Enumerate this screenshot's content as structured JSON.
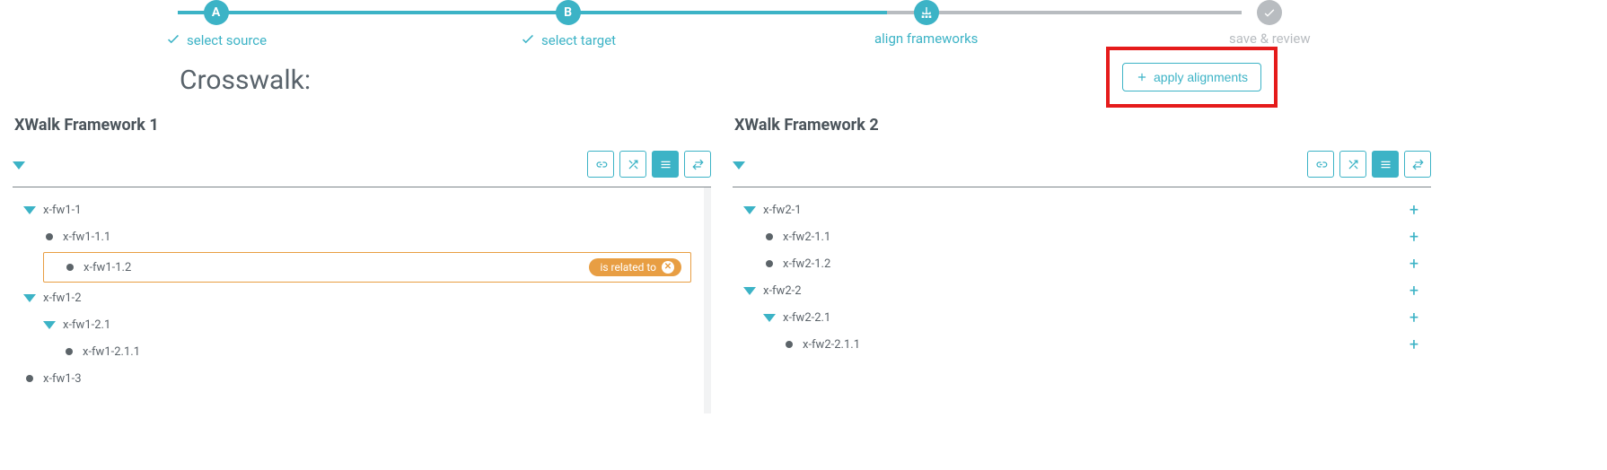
{
  "stepper": {
    "steps": [
      {
        "badge": "A",
        "label": "select source",
        "complete": true
      },
      {
        "badge": "B",
        "label": "select target",
        "complete": true
      },
      {
        "badge": "chart",
        "label": "align frameworks",
        "complete": false,
        "active": true
      },
      {
        "badge": "check",
        "label": "save & review",
        "complete": false
      }
    ]
  },
  "header": {
    "title": "Crosswalk:",
    "apply_label": "apply alignments"
  },
  "left_panel": {
    "title": "XWalk Framework 1",
    "toolbar": [
      "link",
      "shuffle",
      "list",
      "swap"
    ],
    "tree": [
      {
        "id": "x-fw1-1",
        "indent": 0,
        "expander": "caret"
      },
      {
        "id": "x-fw1-1.1",
        "indent": 1,
        "expander": "bullet"
      },
      {
        "id": "x-fw1-1.2",
        "indent": 1,
        "expander": "bullet",
        "selected": true,
        "relation": "is related to"
      },
      {
        "id": "x-fw1-2",
        "indent": 0,
        "expander": "caret"
      },
      {
        "id": "x-fw1-2.1",
        "indent": 1,
        "expander": "caret"
      },
      {
        "id": "x-fw1-2.1.1",
        "indent": 2,
        "expander": "bullet"
      },
      {
        "id": "x-fw1-3",
        "indent": 0,
        "expander": "bullet"
      }
    ]
  },
  "right_panel": {
    "title": "XWalk Framework 2",
    "toolbar": [
      "link",
      "shuffle",
      "list",
      "swap"
    ],
    "tree": [
      {
        "id": "x-fw2-1",
        "indent": 0,
        "expander": "caret"
      },
      {
        "id": "x-fw2-1.1",
        "indent": 1,
        "expander": "bullet"
      },
      {
        "id": "x-fw2-1.2",
        "indent": 1,
        "expander": "bullet"
      },
      {
        "id": "x-fw2-2",
        "indent": 0,
        "expander": "caret"
      },
      {
        "id": "x-fw2-2.1",
        "indent": 1,
        "expander": "caret"
      },
      {
        "id": "x-fw2-2.1.1",
        "indent": 2,
        "expander": "bullet"
      }
    ]
  }
}
